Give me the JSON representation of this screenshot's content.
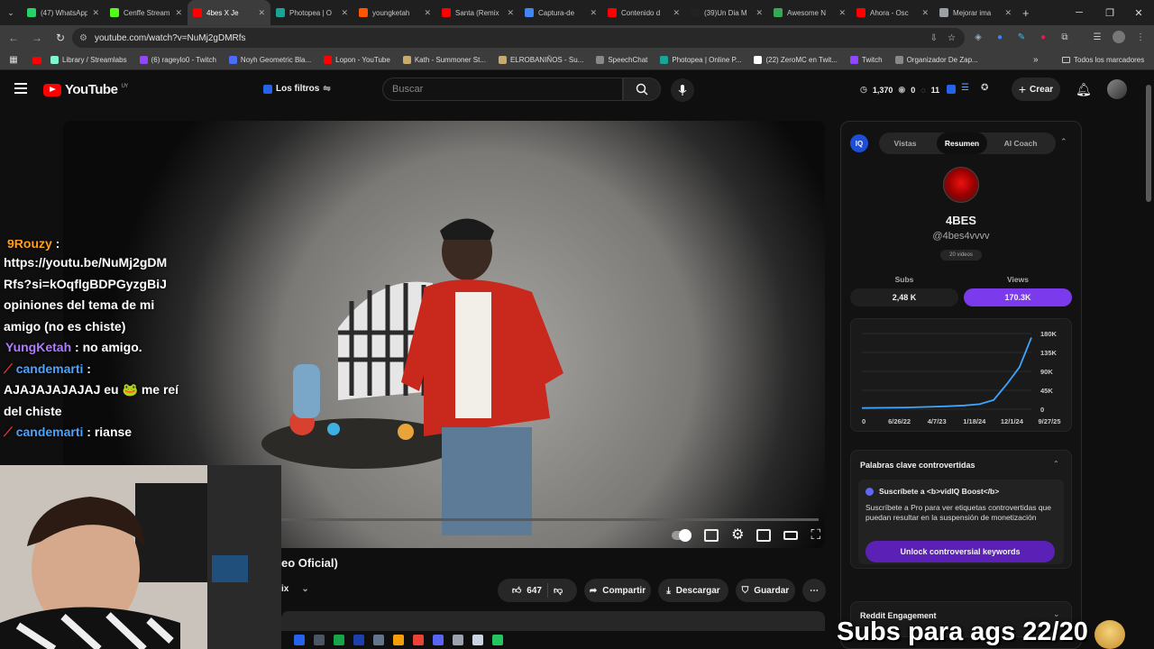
{
  "browser": {
    "tabs": [
      {
        "title": "(47) WhatsApp",
        "color": "#25d366"
      },
      {
        "title": "Cenffe Stream",
        "color": "#53fc18"
      },
      {
        "title": "4bes X Je",
        "color": "#ff0000",
        "active": true
      },
      {
        "title": "Photopea | O",
        "color": "#18a497"
      },
      {
        "title": "youngketah",
        "color": "#ff5500"
      },
      {
        "title": "Santa (Remix",
        "color": "#ff0000"
      },
      {
        "title": "Captura-de",
        "color": "#4285f4"
      },
      {
        "title": "Contenido d",
        "color": "#ff0000"
      },
      {
        "title": "(39)Un Dia M",
        "color": "#222222"
      },
      {
        "title": "Awesome N",
        "color": "#34a853"
      },
      {
        "title": "Ahora - Osc",
        "color": "#ff0000"
      },
      {
        "title": "Mejorar ima",
        "color": "#9aa0a6"
      }
    ],
    "new_tab": "+",
    "url": "youtube.com/watch?v=NuMj2gDMRfs",
    "bookmarks": [
      {
        "label": "Library / Streamlabs",
        "color": "#80f5d2"
      },
      {
        "label": "(6) rageylo0 - Twitch",
        "color": "#9146ff"
      },
      {
        "label": "Noyh Geometric Bla...",
        "color": "#4a6cf7"
      },
      {
        "label": "Lopon - YouTube",
        "color": "#ff0000"
      },
      {
        "label": "Kath - Summoner St...",
        "color": "#c8aa6e"
      },
      {
        "label": "ELROBANIÑOS - Su...",
        "color": "#c8aa6e"
      },
      {
        "label": "SpeechChat",
        "color": "#888888"
      },
      {
        "label": "Photopea | Online P...",
        "color": "#18a497"
      },
      {
        "label": "(22) ZeroMC en Twit...",
        "color": "#ffffff"
      },
      {
        "label": "Twitch",
        "color": "#9146ff"
      },
      {
        "label": "Organizador De Zap...",
        "color": "#888888"
      }
    ],
    "all_bookmarks": "Todos los marcadores"
  },
  "youtube": {
    "logo": "YouTube",
    "region": "UY",
    "filters": "Los filtros",
    "search_placeholder": "Buscar",
    "stats": {
      "views": "1,370",
      "a": "0",
      "b": "11"
    },
    "create": "Crear"
  },
  "video": {
    "title_fragment": "eo Oficial)",
    "channel_fragment": "ix",
    "likes": "647",
    "share": "Compartir",
    "download": "Descargar",
    "save": "Guardar"
  },
  "chat": [
    {
      "user": "9Rouzy",
      "user_color": "#ff9f1a",
      "text": ""
    },
    {
      "user": "",
      "text": "https://youtu.be/NuMj2gDM Rfs?si=kOqflgBDPGyzgBiJ opiniones del tema de mi amigo (no es chiste)"
    },
    {
      "user": "YungKetah",
      "user_color": "#b07cff",
      "text": ": no amigo."
    },
    {
      "user": "candemarti",
      "user_color": "#4aa3ff",
      "text": ": AJAJAJAJAJAJ eu 🐸 me reí del chiste"
    },
    {
      "user": "candemarti",
      "user_color": "#4aa3ff",
      "text": ": rianse"
    }
  ],
  "vidiq": {
    "tabs": [
      "Vistas",
      "Resumen",
      "AI Coach"
    ],
    "active_tab": "Resumen",
    "channel_name": "4BES",
    "handle": "@4bes4vvvv",
    "videos": "20 videos",
    "subs_label": "Subs",
    "subs_value": "2,48 K",
    "views_label": "Views",
    "views_value": "170.3K",
    "keywords_title": "Palabras clave controvertidas",
    "promo_title": "Suscríbete a <b>vidIQ Boost</b>",
    "promo_text": "Suscríbete a Pro para ver etiquetas controvertidas que puedan resultar en la suspensión de monetización",
    "unlock": "Unlock controversial keywords",
    "reddit": "Reddit Engagement"
  },
  "chart_data": {
    "type": "line",
    "x": [
      "0",
      "6/26/22",
      "4/7/23",
      "1/18/24",
      "12/1/24",
      "9/27/25"
    ],
    "y_ticks": [
      "180K",
      "135K",
      "90K",
      "45K",
      "0"
    ],
    "ylim": [
      0,
      180000
    ],
    "series": [
      {
        "values": [
          3000,
          4000,
          5500,
          7000,
          9000,
          12000,
          22000,
          60000,
          100000,
          170300
        ]
      }
    ],
    "line_color": "#3ea6ff"
  },
  "overlay": {
    "subs_text": "Subs para ags 22/20"
  }
}
